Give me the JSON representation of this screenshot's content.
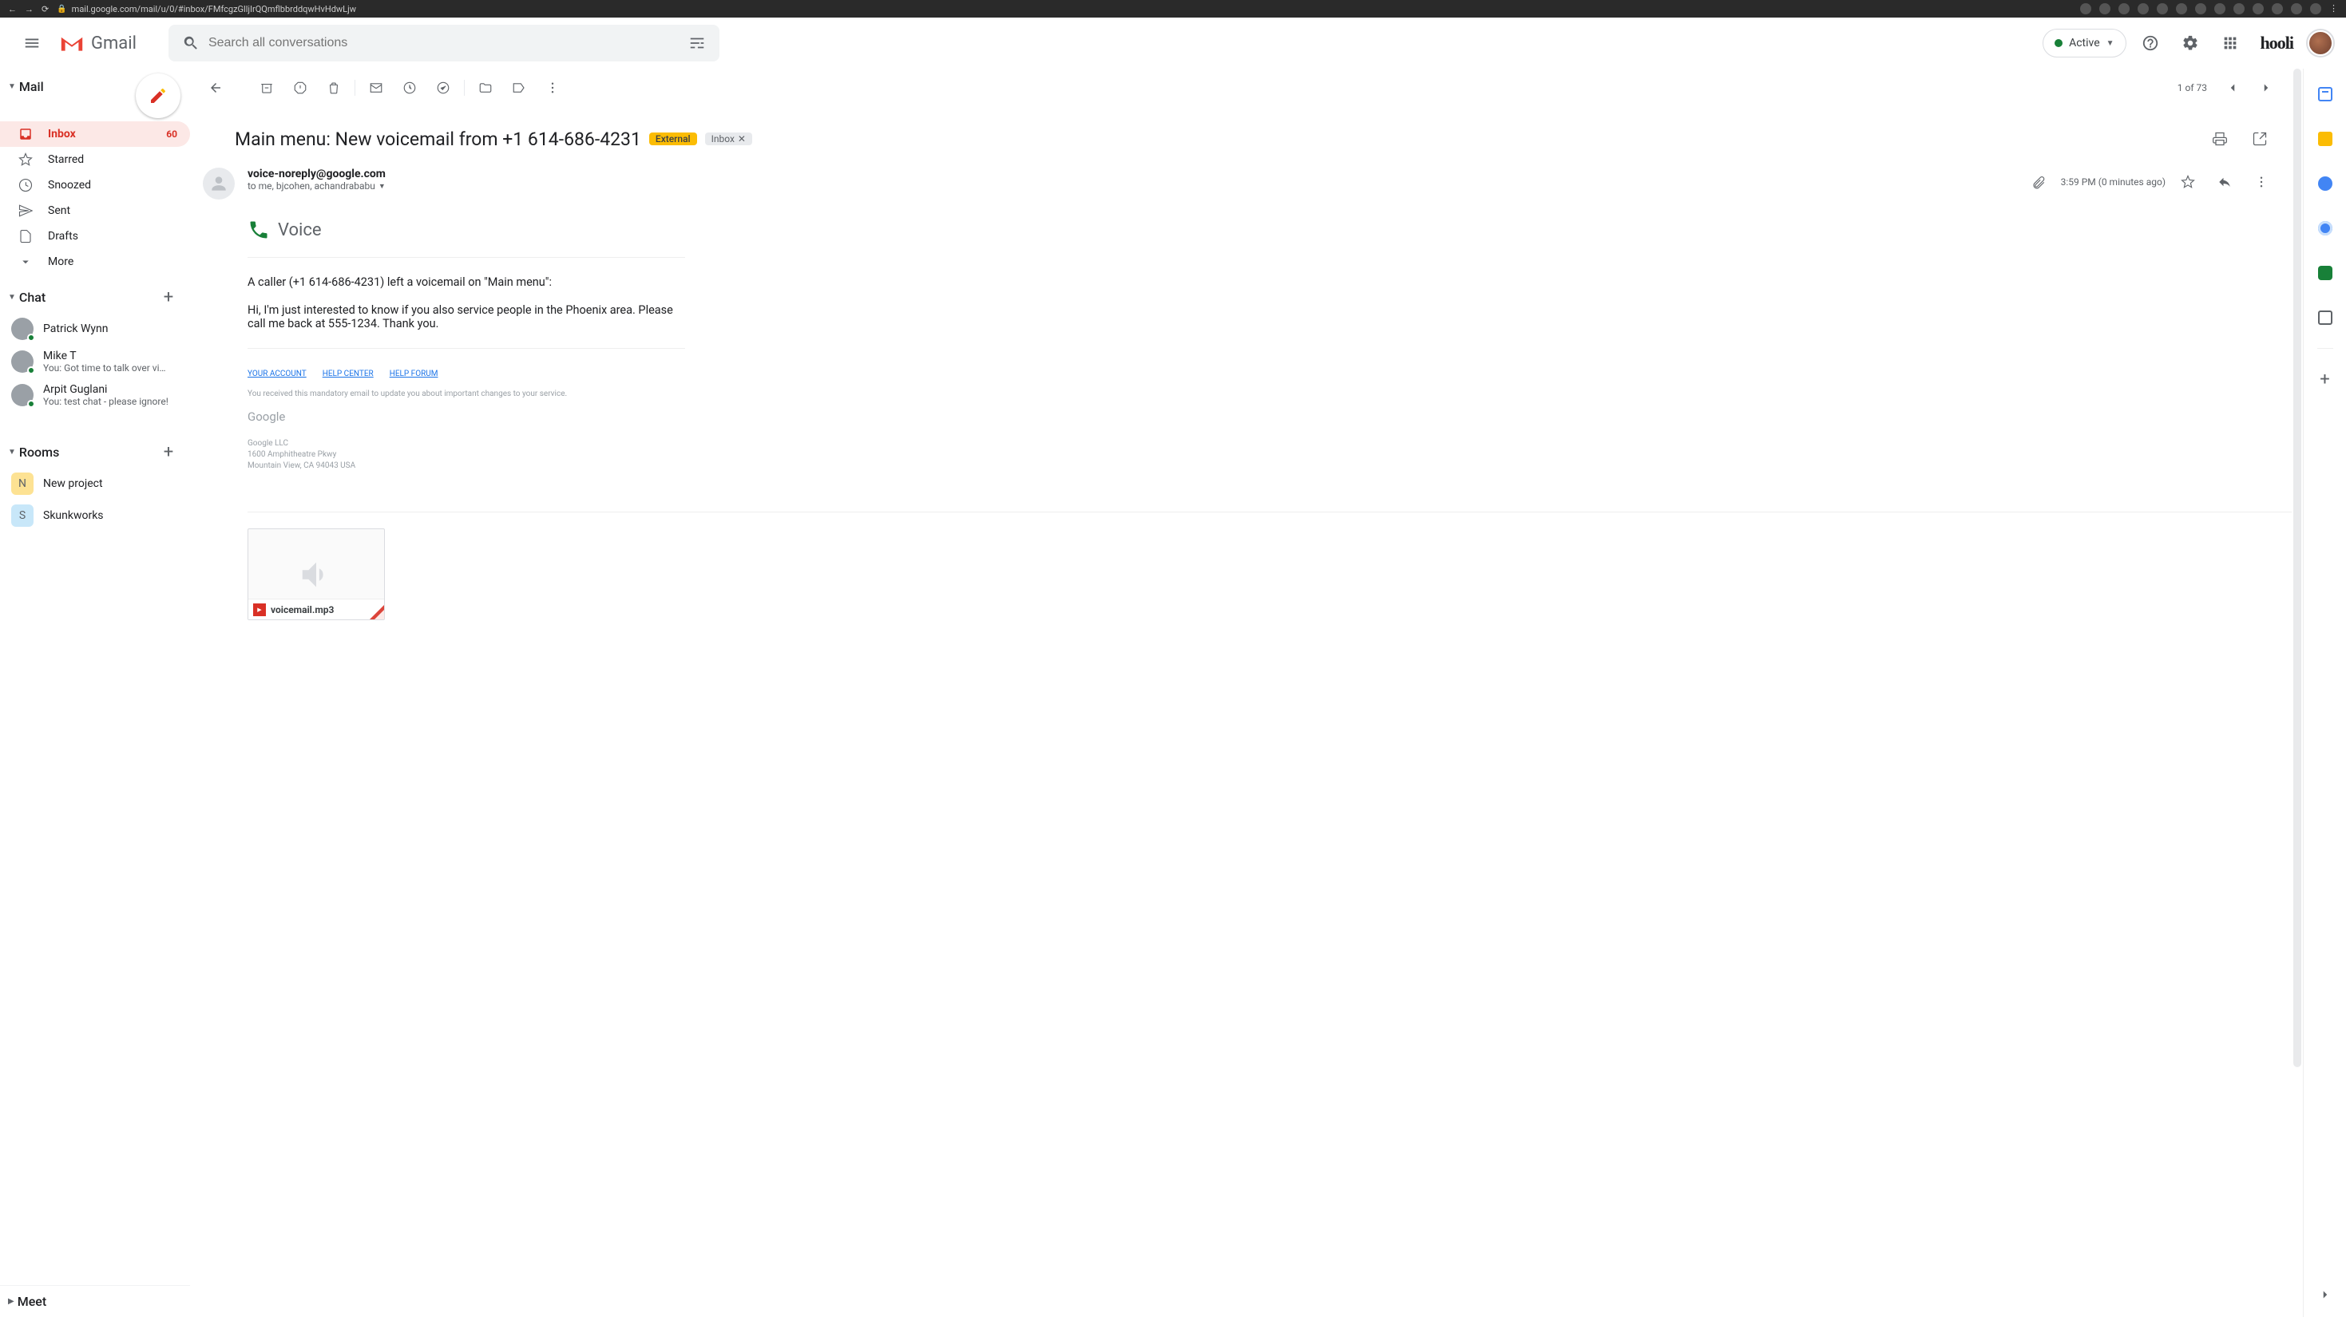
{
  "browser": {
    "url": "mail.google.com/mail/u/0/#inbox/FMfcgzGlljIrQQmflbbrddqwHvHdwLjw"
  },
  "header": {
    "app_name": "Gmail",
    "search_placeholder": "Search all conversations",
    "status_label": "Active",
    "org_name": "hooli"
  },
  "sidebar": {
    "sections": {
      "mail": "Mail",
      "chat": "Chat",
      "rooms": "Rooms",
      "meet": "Meet"
    },
    "nav": {
      "inbox": {
        "label": "Inbox",
        "count": "60"
      },
      "starred": {
        "label": "Starred"
      },
      "snoozed": {
        "label": "Snoozed"
      },
      "sent": {
        "label": "Sent"
      },
      "drafts": {
        "label": "Drafts"
      },
      "more": {
        "label": "More"
      }
    },
    "chats": [
      {
        "name": "Patrick Wynn",
        "sub": ""
      },
      {
        "name": "Mike T",
        "sub": "You: Got time to talk over vid..."
      },
      {
        "name": "Arpit Guglani",
        "sub": "You: test chat - please ignore!"
      }
    ],
    "rooms": [
      {
        "initial": "N",
        "name": "New project"
      },
      {
        "initial": "S",
        "name": "Skunkworks"
      }
    ]
  },
  "toolbar": {
    "page_indicator": "1 of 73"
  },
  "email": {
    "subject": "Main menu: New voicemail from +1 614-686-4231",
    "chips": {
      "external": "External",
      "inbox": "Inbox"
    },
    "sender": "voice-noreply@google.com",
    "to_line": "to me, bjcohen, achandrababu",
    "time": "3:59 PM (0 minutes ago)",
    "voice_brand": "Voice",
    "body_intro": "A caller (+1 614-686-4231) left a voicemail on \"Main menu\":",
    "body_transcript": "Hi, I'm just interested to know if you also service people in the Phoenix area. Please call me back at 555-1234. Thank you.",
    "footer_links": {
      "account": "YOUR ACCOUNT",
      "help": "HELP CENTER",
      "forum": "HELP FORUM"
    },
    "disclaimer": "You received this mandatory email to update you about important changes to your service.",
    "google_logo": "Google",
    "address": {
      "l1": "Google LLC",
      "l2": "1600 Amphitheatre Pkwy",
      "l3": "Mountain View, CA 94043 USA"
    },
    "attachment": {
      "name": "voicemail.mp3"
    }
  }
}
